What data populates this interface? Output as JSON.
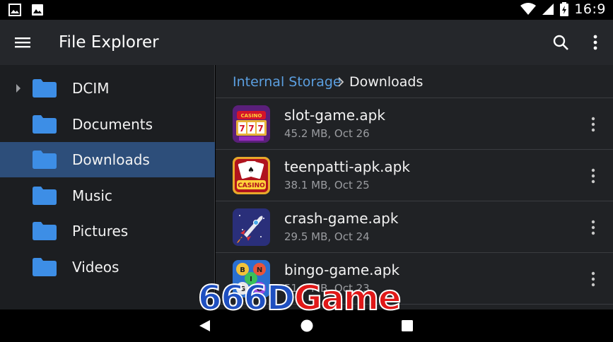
{
  "status_bar": {
    "time": "16:9",
    "left_icons": [
      "image-icon",
      "photo-icon"
    ],
    "right_icons": [
      "wifi-icon",
      "signal-icon",
      "battery-icon"
    ]
  },
  "app_bar": {
    "title": "File Explorer",
    "menu_icon": "hamburger-menu-icon",
    "search_icon": "search-icon",
    "overflow_icon": "more-vert-icon"
  },
  "sidebar": {
    "items": [
      {
        "label": "DCIM",
        "icon": "folder-icon",
        "expandable": true
      },
      {
        "label": "Documents",
        "icon": "folder-icon"
      },
      {
        "label": "Downloads",
        "icon": "folder-icon",
        "selected": true
      },
      {
        "label": "Music",
        "icon": "folder-icon"
      },
      {
        "label": "Pictures",
        "icon": "folder-icon"
      },
      {
        "label": "Videos",
        "icon": "folder-icon"
      }
    ]
  },
  "breadcrumb": {
    "root": "Internal Storage",
    "current": "Downloads"
  },
  "files": [
    {
      "name": "slot-game.apk",
      "meta": "45.2 MB, Oct 26",
      "icon": "slot-machine-icon"
    },
    {
      "name": "teenpatti-apk.apk",
      "meta": "38.1 MB, Oct 25",
      "icon": "casino-cards-icon"
    },
    {
      "name": "crash-game.apk",
      "meta": "29.5 MB, Oct 24",
      "icon": "rocket-icon"
    },
    {
      "name": "bingo-game.apk",
      "meta": "51.0 MB, Oct 23",
      "icon": "bingo-balls-icon"
    }
  ],
  "watermark": {
    "part1": "666D",
    "part2": "Game"
  },
  "colors": {
    "accent": "#5b9fe0",
    "selected_bg": "#2d4e7a",
    "folder": "#3d8ee6",
    "appbar": "#25272b"
  }
}
